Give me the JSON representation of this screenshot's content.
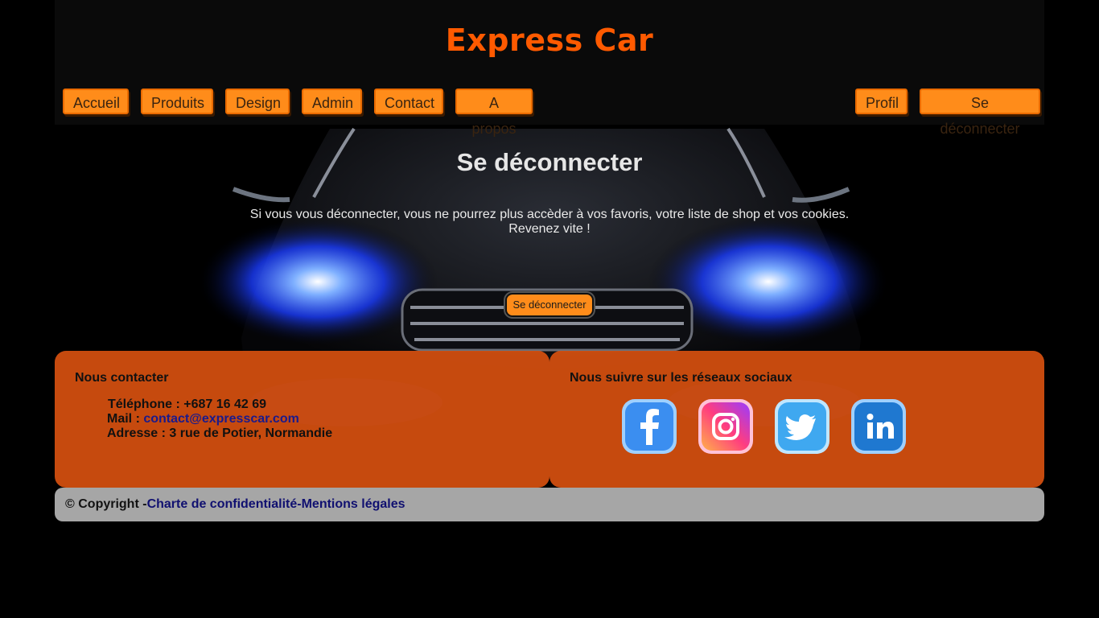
{
  "brand": {
    "title": "Express Car",
    "accent": "#ff5a00"
  },
  "nav": {
    "left": [
      "Accueil",
      "Produits",
      "Design",
      "Admin",
      "Contact",
      "A propos"
    ],
    "right": [
      "Profil",
      "Se déconnecter"
    ]
  },
  "main": {
    "title": "Se déconnecter",
    "message_line1": "Si vous vous déconnecter, vous ne pourrez plus accèder à vos favoris, votre liste de shop et vos cookies.",
    "message_line2": "Revenez vite !",
    "button_label": "Se déconnecter"
  },
  "footer": {
    "contact_heading": "Nous contacter",
    "phone": "Téléphone : +687 16 42 69",
    "mail_label": "Mail : ",
    "mail_value": "contact@expresscar.com",
    "address": "Adresse : 3 rue de Potier, Normandie",
    "social_heading": "Nous suivre sur les réseaux sociaux",
    "socials": [
      "facebook-icon",
      "instagram-icon",
      "twitter-icon",
      "linkedin-icon"
    ],
    "panel_color": "#d7500f"
  },
  "copyright": {
    "prefix": "© Copyright -",
    "privacy": "Charte de confidentialité",
    "separator": "-",
    "legal": "Mentions légales"
  }
}
